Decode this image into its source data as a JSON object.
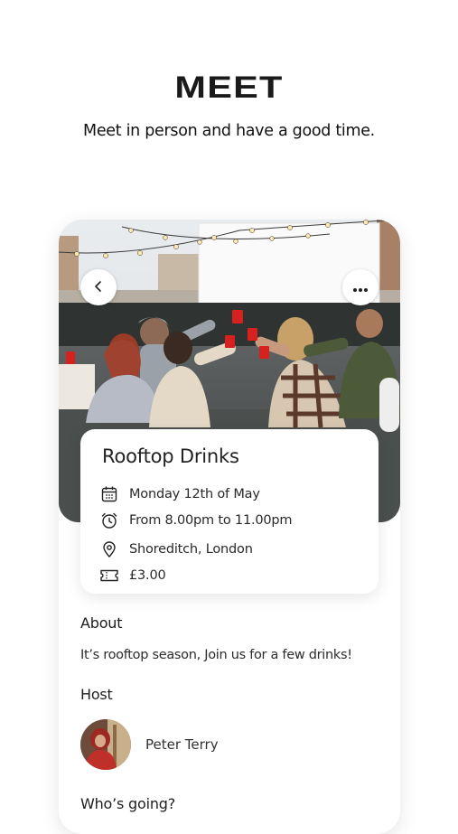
{
  "header": {
    "brand": "MEET",
    "tagline": "Meet in person and have a good time."
  },
  "event": {
    "title": "Rooftop Drinks",
    "date": "Monday 12th of May",
    "time": "From 8.00pm to 11.00pm",
    "location": "Shoreditch, London",
    "price": "£3.00"
  },
  "about": {
    "heading": "About",
    "text": "It’s rooftop season, Join us for a few drinks!"
  },
  "host": {
    "heading": "Host",
    "name": "Peter Terry"
  },
  "attendees": {
    "heading": "Who’s going?"
  },
  "icons": {
    "back": "chevron-left-icon",
    "more": "more-horizontal-icon",
    "date": "calendar-icon",
    "time": "alarm-clock-icon",
    "location": "map-pin-icon",
    "price": "ticket-icon"
  },
  "colors": {
    "background": "#ffffff",
    "text": "#1f1f1f",
    "accent_cup": "#d6211f"
  }
}
